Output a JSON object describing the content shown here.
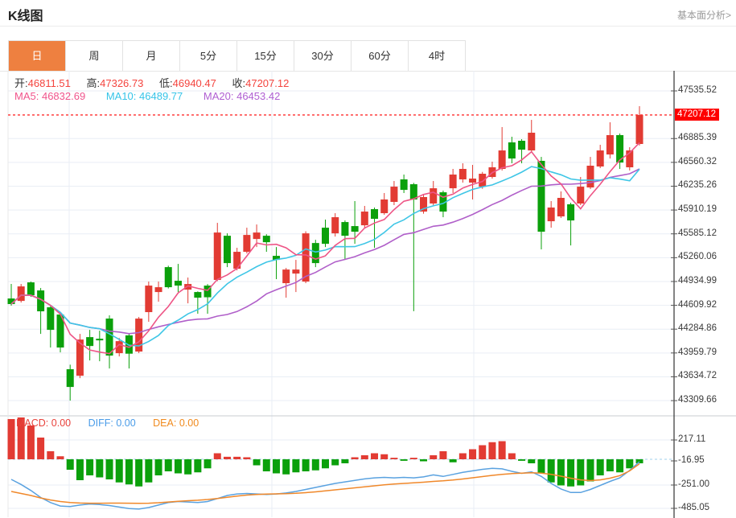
{
  "header": {
    "title": "K线图",
    "link": "基本面分析>"
  },
  "tabs": {
    "items": [
      {
        "label": "日",
        "selected": true
      },
      {
        "label": "周",
        "selected": false
      },
      {
        "label": "月",
        "selected": false
      },
      {
        "label": "5分",
        "selected": false
      },
      {
        "label": "15分",
        "selected": false
      },
      {
        "label": "30分",
        "selected": false
      },
      {
        "label": "60分",
        "selected": false
      },
      {
        "label": "4时",
        "selected": false
      }
    ]
  },
  "quote_bar": {
    "open_label": "开:",
    "open": "46811.51",
    "high_label": "高:",
    "high": "47326.73",
    "low_label": "低:",
    "low": "46940.47",
    "close_label": "收:",
    "close": "47207.12"
  },
  "ma_bar": {
    "ma5_label": "MA5:",
    "ma5": "46832.69",
    "ma10_label": "MA10:",
    "ma10": "46489.77",
    "ma20_label": "MA20:",
    "ma20": "46453.42"
  },
  "macd_bar": {
    "macd_label": "MACD:",
    "macd": "0.00",
    "diff_label": "DIFF:",
    "diff": "0.00",
    "dea_label": "DEA:",
    "dea": "0.00"
  },
  "colors": {
    "up_candle": "#e23b33",
    "down_candle": "#0ba00b",
    "ma5": "#ee5586",
    "ma10": "#3fc6e6",
    "ma20": "#b05fc9",
    "diff_line": "#5aa2e0",
    "dea_line": "#f0882a",
    "price_line": "#ff2d2d",
    "price_box": "#fe0000",
    "grid": "#e9eef5",
    "axis": "#333333",
    "selected_tab": "#ee8040",
    "zero_dash": "#9fd0ee"
  },
  "chart_data": {
    "type": "candlestick",
    "title": "K线图",
    "legend": [
      "MA5",
      "MA10",
      "MA20"
    ],
    "main_axis": {
      "value_top": 47535.52,
      "value_bottom": 43309.66,
      "tick_step": 325.07,
      "tick_labels": [
        "47535.52",
        "46885.39",
        "46560.32",
        "46235.26",
        "45910.19",
        "45585.12",
        "45260.06",
        "44934.99",
        "44609.92",
        "44284.86",
        "43959.79",
        "43634.72",
        "43309.66"
      ],
      "price_marker": "47207.12",
      "price_marker_value": 47207.12
    },
    "candles": [
      [
        44703,
        44901,
        44605,
        44627
      ],
      [
        44670,
        44901,
        44648,
        44868
      ],
      [
        44923,
        44934,
        44725,
        44747
      ],
      [
        44813,
        44846,
        44220,
        44528
      ],
      [
        44583,
        44600,
        44034,
        44275
      ],
      [
        44484,
        44500,
        43968,
        44034
      ],
      [
        43738,
        43800,
        43310,
        43496
      ],
      [
        43649,
        44220,
        43616,
        44143
      ],
      [
        44176,
        44275,
        43858,
        44055
      ],
      [
        44154,
        44264,
        43847,
        44132
      ],
      [
        44429,
        44473,
        43748,
        43924
      ],
      [
        43957,
        44165,
        43913,
        44121
      ],
      [
        44200,
        44230,
        43748,
        43950
      ],
      [
        43979,
        44451,
        43957,
        44429
      ],
      [
        44517,
        44934,
        44385,
        44879
      ],
      [
        44791,
        44934,
        44659,
        44857
      ],
      [
        45131,
        45150,
        44840,
        44857
      ],
      [
        44945,
        45175,
        44791,
        44879
      ],
      [
        44824,
        44989,
        44637,
        44901
      ],
      [
        44791,
        44800,
        44495,
        44714
      ],
      [
        44879,
        44900,
        44495,
        44720
      ],
      [
        44956,
        45735,
        44940,
        45603
      ],
      [
        45559,
        45592,
        45131,
        45186
      ],
      [
        45109,
        45395,
        45087,
        45340
      ],
      [
        45340,
        45669,
        45318,
        45570
      ],
      [
        45515,
        45713,
        45405,
        45603
      ],
      [
        45559,
        45580,
        45340,
        45471
      ],
      [
        45285,
        45405,
        44967,
        45230
      ],
      [
        44912,
        45120,
        44714,
        45098
      ],
      [
        45043,
        45230,
        44791,
        45098
      ],
      [
        44934,
        45620,
        44912,
        45592
      ],
      [
        45460,
        45504,
        45131,
        45186
      ],
      [
        45669,
        45779,
        45405,
        45449
      ],
      [
        45592,
        45867,
        45548,
        45812
      ],
      [
        45746,
        45768,
        45230,
        45559
      ],
      [
        45691,
        46032,
        45449,
        45614
      ],
      [
        45702,
        45966,
        45669,
        45889
      ],
      [
        45922,
        45944,
        45394,
        45790
      ],
      [
        45867,
        46142,
        45845,
        46054
      ],
      [
        46021,
        46306,
        45977,
        46229
      ],
      [
        46328,
        46394,
        46142,
        46185
      ],
      [
        46262,
        46280,
        44530,
        46054
      ],
      [
        45889,
        46120,
        45860,
        46087
      ],
      [
        45999,
        46306,
        45977,
        46207
      ],
      [
        46152,
        46175,
        45812,
        45889
      ],
      [
        46207,
        46471,
        46142,
        46394
      ],
      [
        46328,
        46548,
        46284,
        46471
      ],
      [
        46284,
        46526,
        46054,
        46339
      ],
      [
        46229,
        46430,
        46200,
        46405
      ],
      [
        46361,
        46570,
        46339,
        46493
      ],
      [
        46471,
        47042,
        46449,
        46723
      ],
      [
        46833,
        46910,
        46548,
        46613
      ],
      [
        46855,
        46877,
        46548,
        46734
      ],
      [
        46723,
        47140,
        46701,
        46965
      ],
      [
        46581,
        46635,
        45373,
        45614
      ],
      [
        45757,
        46032,
        45669,
        45944
      ],
      [
        45823,
        46164,
        45801,
        46076
      ],
      [
        45988,
        46010,
        45427,
        45768
      ],
      [
        45999,
        46361,
        45977,
        46229
      ],
      [
        46218,
        46635,
        46196,
        46515
      ],
      [
        46504,
        46800,
        46482,
        46723
      ],
      [
        46668,
        47107,
        46613,
        46932
      ],
      [
        46932,
        46954,
        46471,
        46558
      ],
      [
        46493,
        46767,
        46450,
        46723
      ],
      [
        46811,
        47327,
        46790,
        47207
      ]
    ],
    "macd": {
      "y_ticks": [
        "217.11",
        "-16.95",
        "-251.00",
        "-485.05"
      ],
      "hist": [
        400,
        416,
        336,
        216,
        80,
        30,
        -104,
        -208,
        -160,
        -180,
        -200,
        -230,
        -250,
        -270,
        -230,
        -160,
        -120,
        -140,
        -150,
        -130,
        -90,
        60,
        25,
        25,
        20,
        -60,
        -120,
        -140,
        -150,
        -130,
        -120,
        -110,
        -90,
        -60,
        -40,
        20,
        40,
        60,
        50,
        15,
        -15,
        15,
        -20,
        40,
        80,
        -30,
        60,
        100,
        140,
        170,
        180,
        60,
        -15,
        -40,
        -140,
        -230,
        -260,
        -270,
        -260,
        -220,
        -160,
        -120,
        -130,
        -90,
        -40
      ],
      "dif": [
        -200,
        -250,
        -310,
        -380,
        -430,
        -465,
        -470,
        -455,
        -445,
        -450,
        -460,
        -475,
        -490,
        -495,
        -480,
        -455,
        -430,
        -420,
        -425,
        -430,
        -420,
        -390,
        -360,
        -345,
        -340,
        -345,
        -350,
        -345,
        -335,
        -320,
        -300,
        -280,
        -260,
        -240,
        -225,
        -210,
        -195,
        -185,
        -180,
        -185,
        -180,
        -185,
        -175,
        -155,
        -170,
        -150,
        -130,
        -115,
        -100,
        -90,
        -95,
        -120,
        -140,
        -125,
        -170,
        -240,
        -295,
        -330,
        -330,
        -300,
        -260,
        -220,
        -185,
        -110,
        -25
      ],
      "dea": [
        -320,
        -340,
        -360,
        -385,
        -405,
        -420,
        -430,
        -435,
        -437,
        -437,
        -436,
        -436,
        -437,
        -438,
        -437,
        -432,
        -425,
        -418,
        -412,
        -407,
        -400,
        -390,
        -378,
        -366,
        -356,
        -350,
        -346,
        -344,
        -342,
        -338,
        -332,
        -324,
        -314,
        -304,
        -294,
        -284,
        -274,
        -264,
        -254,
        -246,
        -240,
        -234,
        -228,
        -220,
        -214,
        -206,
        -196,
        -184,
        -172,
        -160,
        -150,
        -142,
        -138,
        -134,
        -138,
        -150,
        -168,
        -188,
        -205,
        -212,
        -205,
        -188,
        -162,
        -115,
        -45
      ]
    }
  }
}
